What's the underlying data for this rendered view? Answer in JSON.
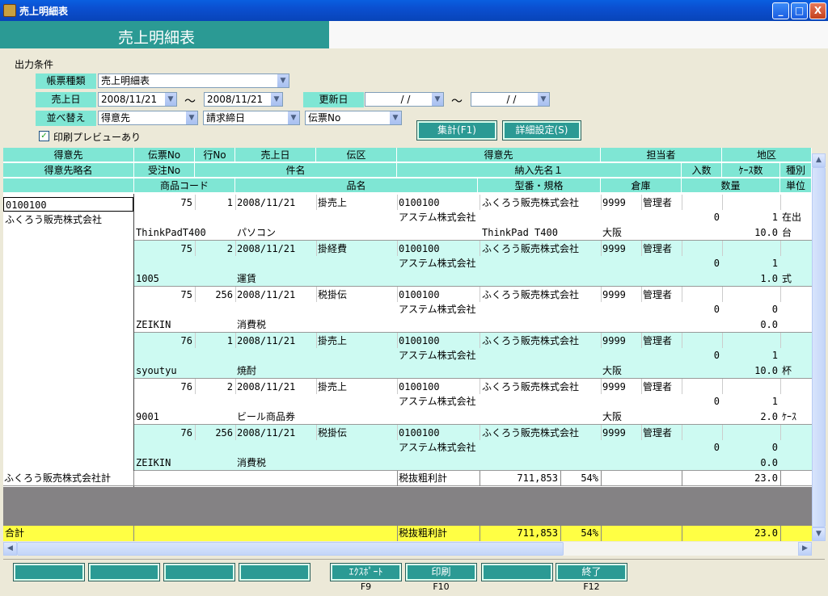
{
  "window": {
    "title": "売上明細表",
    "minimize": "_",
    "maximize": "□",
    "close": "X"
  },
  "header": {
    "title": "売上明細表"
  },
  "conditions": {
    "section_label": "出力条件",
    "report_type_label": "帳票種類",
    "report_type_value": "売上明細表",
    "sales_date_label": "売上日",
    "date_from": "2008/11/21",
    "tilde": "～",
    "date_to": "2008/11/21",
    "updated_label": "更新日",
    "upd_from": "/  /",
    "upd_to": "/  /",
    "sort_label": "並べ替え",
    "sort1": "得意先",
    "sort2": "請求締日",
    "sort3": "伝票No",
    "preview_label": "印刷プレビューあり",
    "preview_checked": "✓",
    "aggregate_button": "集計(F1)",
    "detail_button": "詳細設定(S)"
  },
  "grid": {
    "header_row1": [
      "得意先",
      "伝票No",
      "行No",
      "売上日",
      "伝区",
      "得意先",
      "担当者",
      "地区"
    ],
    "header_row2": [
      "得意先略名",
      "受注No",
      "件名",
      "納入先名１",
      "入数",
      "ｹｰｽ数",
      "種別"
    ],
    "header_row3": [
      "商品コード",
      "品名",
      "型番・規格",
      "倉庫",
      "数量",
      "単位"
    ],
    "customer_code": "0100100",
    "customer_name": "ふくろう販売株式会社",
    "records": [
      {
        "slip": "75",
        "line": "1",
        "date": "2008/11/21",
        "kind": "掛売上",
        "cust_code": "0100100",
        "cust_name": "ふくろう販売株式会社",
        "staff_code": "9999",
        "staff": "管理者",
        "deliver": "アステム株式会社",
        "irisu": "0",
        "cases": "1",
        "type": "在出",
        "item_code": "ThinkPadT400",
        "item_name": "パソコン",
        "model": "ThinkPad T400",
        "warehouse": "大阪",
        "qty": "10.0",
        "unit": "台"
      },
      {
        "slip": "75",
        "line": "2",
        "date": "2008/11/21",
        "kind": "掛経費",
        "cust_code": "0100100",
        "cust_name": "ふくろう販売株式会社",
        "staff_code": "9999",
        "staff": "管理者",
        "deliver": "アステム株式会社",
        "irisu": "0",
        "cases": "1",
        "type": "",
        "item_code": "1005",
        "item_name": "運賃",
        "model": "",
        "warehouse": "",
        "qty": "1.0",
        "unit": "式"
      },
      {
        "slip": "75",
        "line": "256",
        "date": "2008/11/21",
        "kind": "税掛伝",
        "cust_code": "0100100",
        "cust_name": "ふくろう販売株式会社",
        "staff_code": "9999",
        "staff": "管理者",
        "deliver": "アステム株式会社",
        "irisu": "0",
        "cases": "0",
        "type": "",
        "item_code": "ZEIKIN",
        "item_name": "消費税",
        "model": "",
        "warehouse": "",
        "qty": "0.0",
        "unit": ""
      },
      {
        "slip": "76",
        "line": "1",
        "date": "2008/11/21",
        "kind": "掛売上",
        "cust_code": "0100100",
        "cust_name": "ふくろう販売株式会社",
        "staff_code": "9999",
        "staff": "管理者",
        "deliver": "アステム株式会社",
        "irisu": "0",
        "cases": "1",
        "type": "",
        "item_code": "syoutyu",
        "item_name": "焼酎",
        "model": "",
        "warehouse": "大阪",
        "qty": "10.0",
        "unit": "杯"
      },
      {
        "slip": "76",
        "line": "2",
        "date": "2008/11/21",
        "kind": "掛売上",
        "cust_code": "0100100",
        "cust_name": "ふくろう販売株式会社",
        "staff_code": "9999",
        "staff": "管理者",
        "deliver": "アステム株式会社",
        "irisu": "0",
        "cases": "1",
        "type": "",
        "item_code": "9001",
        "item_name": "ビール商品券",
        "model": "",
        "warehouse": "大阪",
        "qty": "2.0",
        "unit": "ｹｰｽ"
      },
      {
        "slip": "76",
        "line": "256",
        "date": "2008/11/21",
        "kind": "税掛伝",
        "cust_code": "0100100",
        "cust_name": "ふくろう販売株式会社",
        "staff_code": "9999",
        "staff": "管理者",
        "deliver": "アステム株式会社",
        "irisu": "0",
        "cases": "0",
        "type": "",
        "item_code": "ZEIKIN",
        "item_name": "消費税",
        "model": "",
        "warehouse": "",
        "qty": "0.0",
        "unit": ""
      }
    ],
    "subtotal": {
      "label": "ふくろう販売株式会社計",
      "profit_label": "税抜粗利計",
      "amount": "711,853",
      "pct": "54%",
      "qty": "23.0"
    },
    "total": {
      "label": "合計",
      "profit_label": "税抜粗利計",
      "amount": "711,853",
      "pct": "54%",
      "qty": "23.0"
    }
  },
  "footer": {
    "buttons": [
      "",
      "",
      "",
      "",
      "ｴｸｽﾎﾟｰﾄ",
      "印刷",
      "",
      "終了"
    ],
    "keys": [
      "",
      "",
      "",
      "",
      "F9",
      "F10",
      "",
      "F12"
    ]
  },
  "colors": {
    "teal": "#2b9a94",
    "mint": "#7fe6d4",
    "row_alt": "#cdfaf2",
    "total": "#ffff44",
    "gray": "#848284"
  }
}
